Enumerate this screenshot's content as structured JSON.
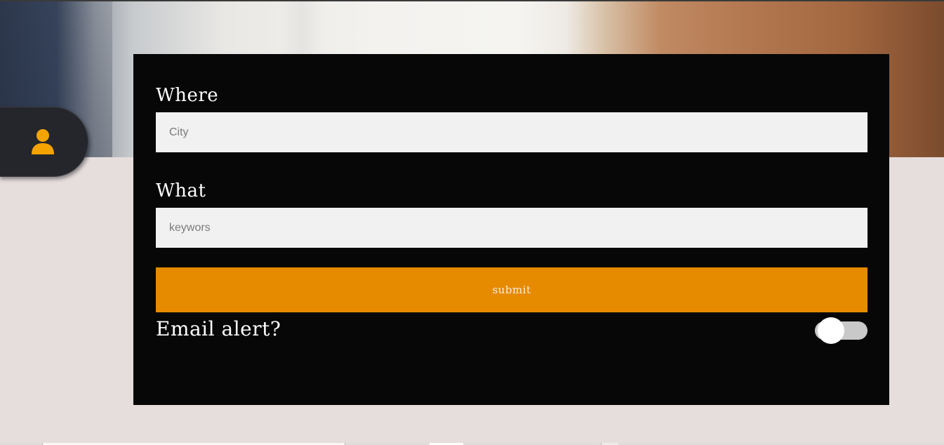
{
  "hero": {
    "description_colors": {
      "dark": "#2f3a4f",
      "light": "#f3f2ef",
      "wood": "#a3673f"
    }
  },
  "user_tab": {
    "icon": "user-icon",
    "icon_color": "#f5a300",
    "background": "#24262b"
  },
  "form": {
    "where_label": "Where",
    "where_placeholder": "City",
    "what_label": "What",
    "what_placeholder": "keywors",
    "submit_label": "submit",
    "email_alert_label": "Email alert?",
    "email_alert_enabled": false
  },
  "colors": {
    "panel": "#070707",
    "accent": "#e68a00",
    "page_bg": "#e6dddd",
    "input_bg": "#f1f1f1",
    "toggle_track": "#c9c9c9"
  }
}
